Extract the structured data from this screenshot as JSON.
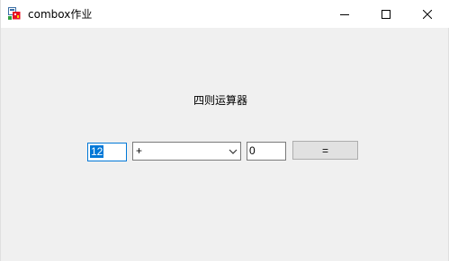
{
  "window": {
    "title": "combox作业",
    "icon": "winforms-app-icon",
    "controls": [
      "minimize-icon",
      "maximize-icon",
      "close-icon"
    ]
  },
  "form": {
    "heading": "四则运算器",
    "operand_a": "12",
    "operator": {
      "selected": "+"
    },
    "operand_b": "0",
    "equals_label": "="
  }
}
